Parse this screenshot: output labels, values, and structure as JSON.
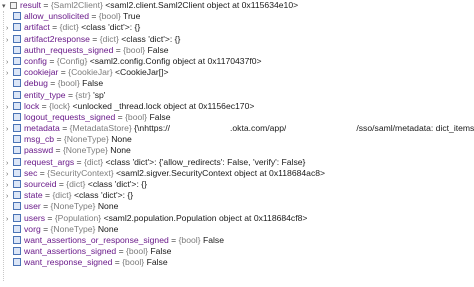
{
  "root": {
    "name": "result",
    "type": "{Saml2Client}",
    "value": "<saml2.client.Saml2Client object at 0x115634e10>"
  },
  "rows": [
    {
      "name": "allow_unsolicited",
      "type": "{bool}",
      "value": "True",
      "expandable": false
    },
    {
      "name": "artifact",
      "type": "{dict}",
      "value": "<class 'dict'>: {}",
      "expandable": true
    },
    {
      "name": "artifact2response",
      "type": "{dict}",
      "value": "<class 'dict'>: {}",
      "expandable": true
    },
    {
      "name": "authn_requests_signed",
      "type": "{bool}",
      "value": "False",
      "expandable": false
    },
    {
      "name": "config",
      "type": "{Config}",
      "value": "<saml2.config.Config object at 0x1170437f0>",
      "expandable": true
    },
    {
      "name": "cookiejar",
      "type": "{CookieJar}",
      "value": "<CookieJar[]>",
      "expandable": true
    },
    {
      "name": "debug",
      "type": "{bool}",
      "value": "False",
      "expandable": false
    },
    {
      "name": "entity_type",
      "type": "{str}",
      "value": "'sp'",
      "expandable": false
    },
    {
      "name": "lock",
      "type": "{lock}",
      "value": "<unlocked _thread.lock object at 0x1156ec170>",
      "expandable": true
    },
    {
      "name": "logout_requests_signed",
      "type": "{bool}",
      "value": "False",
      "expandable": false
    },
    {
      "name": "metadata",
      "type": "{MetadataStore}",
      "value": "{\\nhttps://",
      "value2": ".okta.com/app/",
      "value3": "/sso/saml/metadata: dict_items",
      "expandable": true
    },
    {
      "name": "msg_cb",
      "type": "{NoneType}",
      "value": "None",
      "expandable": false
    },
    {
      "name": "passwd",
      "type": "{NoneType}",
      "value": "None",
      "expandable": false
    },
    {
      "name": "request_args",
      "type": "{dict}",
      "value": "<class 'dict'>: {'allow_redirects': False, 'verify': False}",
      "expandable": true
    },
    {
      "name": "sec",
      "type": "{SecurityContext}",
      "value": "<saml2.sigver.SecurityContext object at 0x118684ac8>",
      "expandable": true
    },
    {
      "name": "sourceid",
      "type": "{dict}",
      "value": "<class 'dict'>: {}",
      "expandable": true
    },
    {
      "name": "state",
      "type": "{dict}",
      "value": "<class 'dict'>: {}",
      "expandable": true
    },
    {
      "name": "user",
      "type": "{NoneType}",
      "value": "None",
      "expandable": false
    },
    {
      "name": "users",
      "type": "{Population}",
      "value": "<saml2.population.Population object at 0x118684cf8>",
      "expandable": true
    },
    {
      "name": "vorg",
      "type": "{NoneType}",
      "value": "None",
      "expandable": false
    },
    {
      "name": "want_assertions_or_response_signed",
      "type": "{bool}",
      "value": "False",
      "expandable": false
    },
    {
      "name": "want_assertions_signed",
      "type": "{bool}",
      "value": "False",
      "expandable": false
    },
    {
      "name": "want_response_signed",
      "type": "{bool}",
      "value": "False",
      "expandable": false
    }
  ],
  "icons": {
    "collapse": "chevron-down-icon",
    "expand": "chevron-right-icon",
    "field": "field-icon",
    "variable": "variable-icon"
  },
  "colors": {
    "name": "#6a1a8a",
    "type": "#7d7d7d",
    "icon_border": "#4a73b5"
  }
}
